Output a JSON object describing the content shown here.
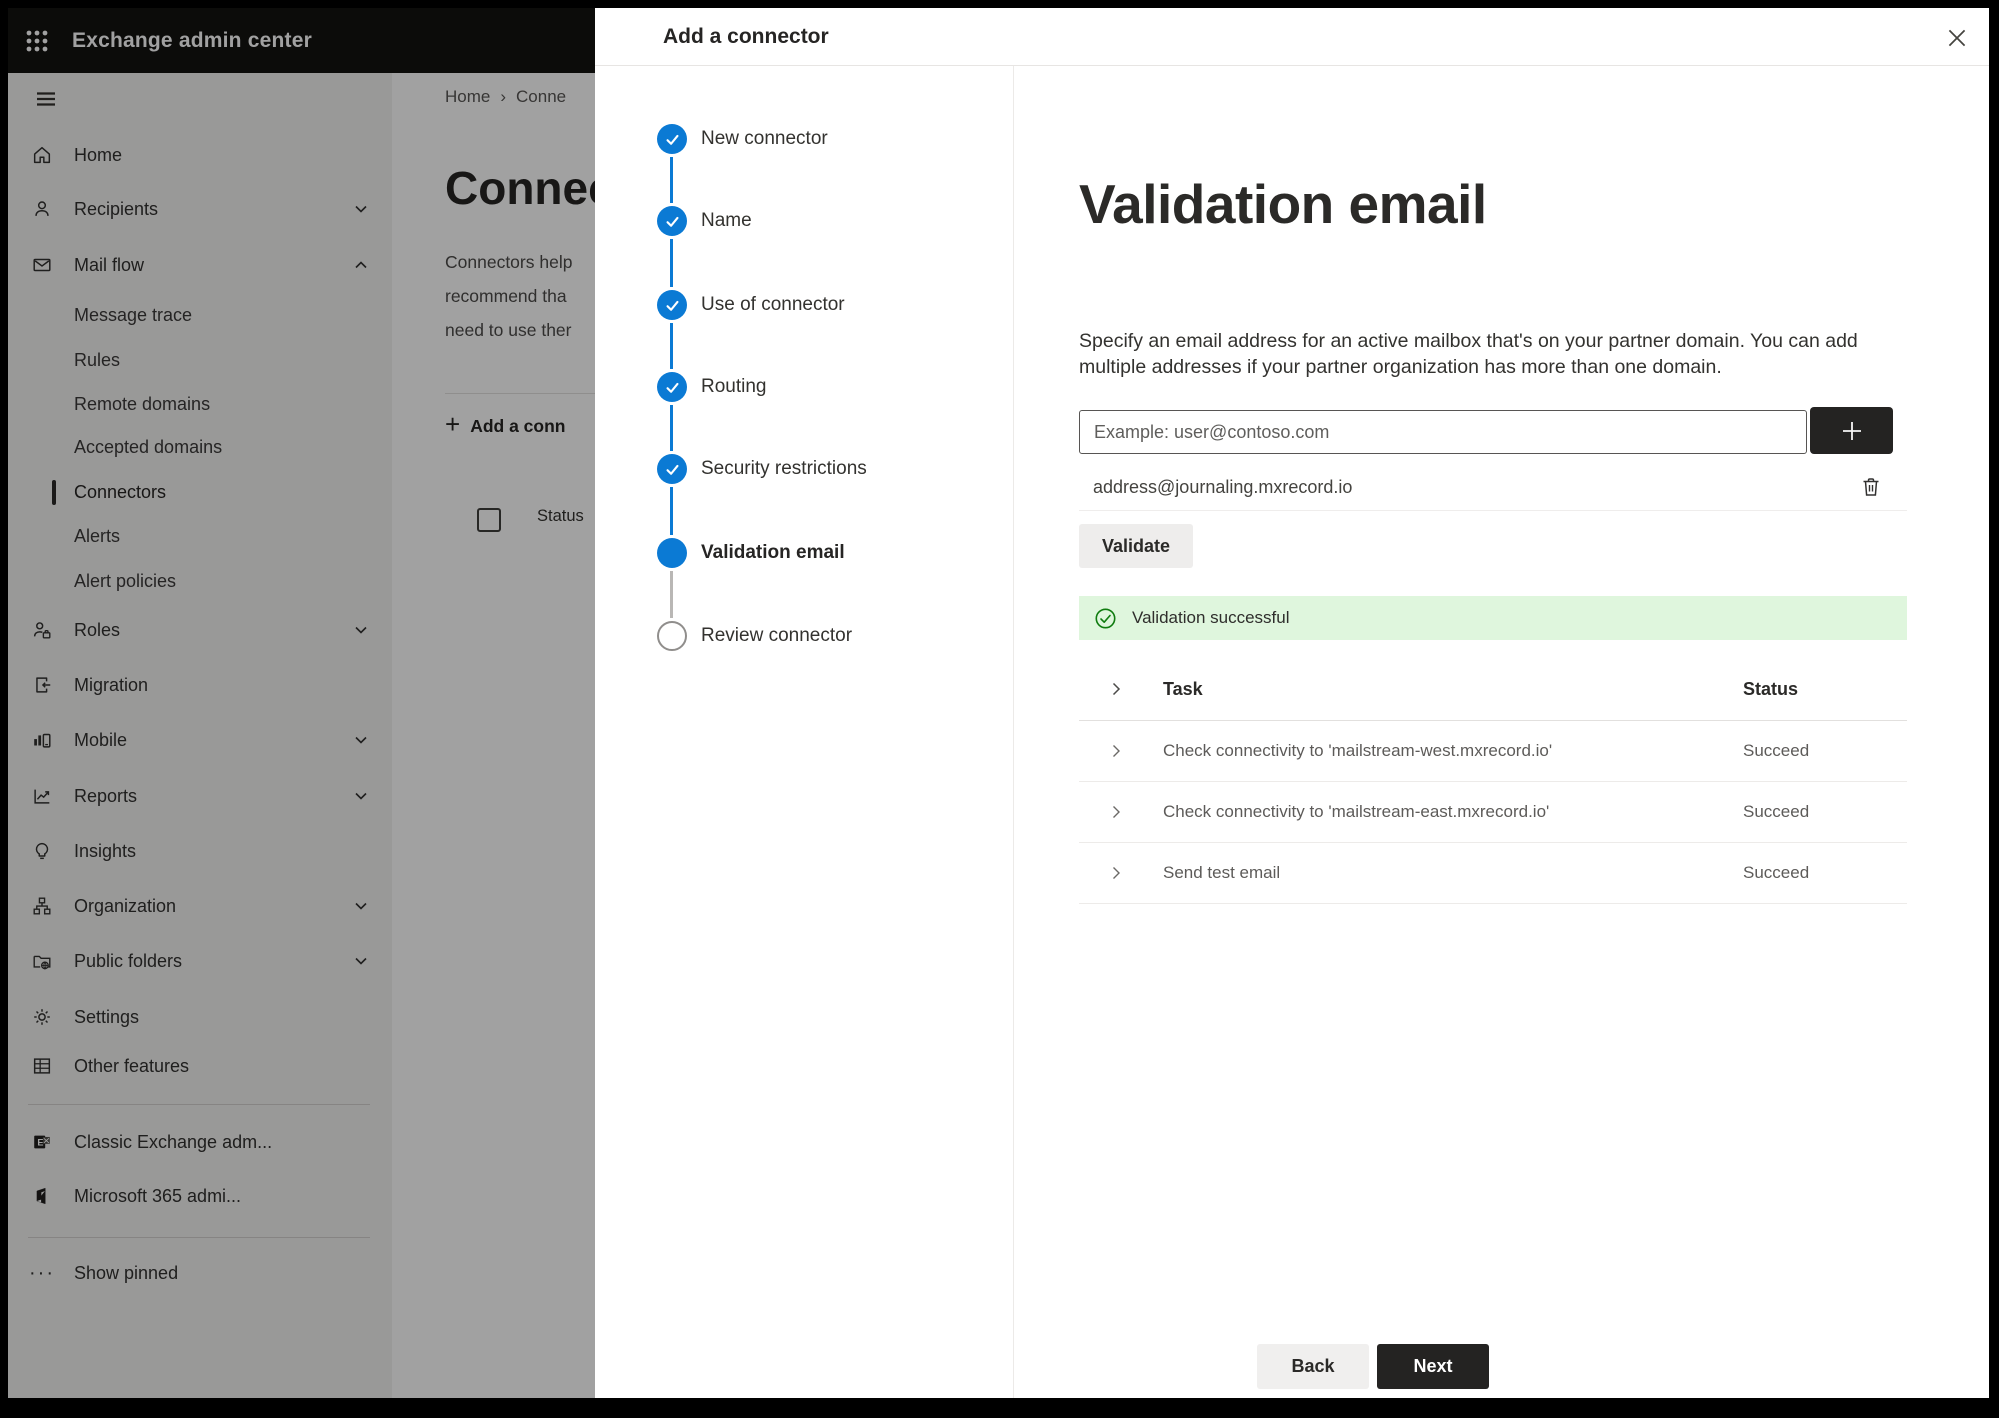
{
  "app": {
    "title": "Exchange admin center"
  },
  "sidebar": {
    "items": [
      {
        "label": "Home",
        "icon": "home"
      },
      {
        "label": "Recipients",
        "icon": "person",
        "chevron": "down"
      },
      {
        "label": "Mail flow",
        "icon": "mail",
        "chevron": "up",
        "expanded": true
      },
      {
        "label": "Message trace",
        "sub": true
      },
      {
        "label": "Rules",
        "sub": true
      },
      {
        "label": "Remote domains",
        "sub": true
      },
      {
        "label": "Accepted domains",
        "sub": true
      },
      {
        "label": "Connectors",
        "sub": true,
        "selected": true
      },
      {
        "label": "Alerts",
        "sub": true
      },
      {
        "label": "Alert policies",
        "sub": true
      },
      {
        "label": "Roles",
        "icon": "person-briefcase",
        "chevron": "down"
      },
      {
        "label": "Migration",
        "icon": "migration"
      },
      {
        "label": "Mobile",
        "icon": "mobile",
        "chevron": "down"
      },
      {
        "label": "Reports",
        "icon": "chart",
        "chevron": "down"
      },
      {
        "label": "Insights",
        "icon": "lightbulb"
      },
      {
        "label": "Organization",
        "icon": "org-chart",
        "chevron": "down"
      },
      {
        "label": "Public folders",
        "icon": "folder-globe",
        "chevron": "down"
      },
      {
        "label": "Settings",
        "icon": "gear"
      },
      {
        "label": "Other features",
        "icon": "table-grid"
      },
      {
        "label": "Classic Exchange adm...",
        "icon": "exchange-logo"
      },
      {
        "label": "Microsoft 365 admi...",
        "icon": "office-logo"
      },
      {
        "label": "Show pinned",
        "icon": "ellipsis"
      }
    ]
  },
  "background": {
    "breadcrumb": {
      "home": "Home",
      "separator": "›",
      "current": "Conne"
    },
    "heading": "Connect",
    "description_lines": [
      "Connectors help",
      "recommend tha",
      "need to use ther"
    ],
    "add_button": "Add a conn",
    "add_plus": "+",
    "status_header": "Status"
  },
  "panel": {
    "title": "Add a connector",
    "steps": [
      {
        "label": "New connector",
        "state": "complete"
      },
      {
        "label": "Name",
        "state": "complete"
      },
      {
        "label": "Use of connector",
        "state": "complete"
      },
      {
        "label": "Routing",
        "state": "complete"
      },
      {
        "label": "Security restrictions",
        "state": "complete"
      },
      {
        "label": "Validation email",
        "state": "current"
      },
      {
        "label": "Review connector",
        "state": "upcoming"
      }
    ],
    "content": {
      "heading": "Validation email",
      "description": "Specify an email address for an active mailbox that's on your partner domain. You can add multiple addresses if your partner organization has more than one domain.",
      "email_input": {
        "value": "",
        "placeholder": "Example: user@contoso.com"
      },
      "addresses": [
        {
          "email": "address@journaling.mxrecord.io"
        }
      ],
      "validate_button": "Validate",
      "banner": {
        "text": "Validation successful"
      },
      "table": {
        "columns": [
          "Task",
          "Status"
        ],
        "rows": [
          {
            "task": "Check connectivity to 'mailstream-west.mxrecord.io'",
            "status": "Succeed"
          },
          {
            "task": "Check connectivity to 'mailstream-east.mxrecord.io'",
            "status": "Succeed"
          },
          {
            "task": "Send test email",
            "status": "Succeed"
          }
        ]
      }
    },
    "footer": {
      "back": "Back",
      "next": "Next"
    }
  },
  "colors": {
    "accent_blue": "#0b7ad4",
    "success_green": "#107c10",
    "success_banner_bg": "#dff6dd",
    "appbar_bg": "#141311",
    "primary_button_bg": "#242322"
  }
}
